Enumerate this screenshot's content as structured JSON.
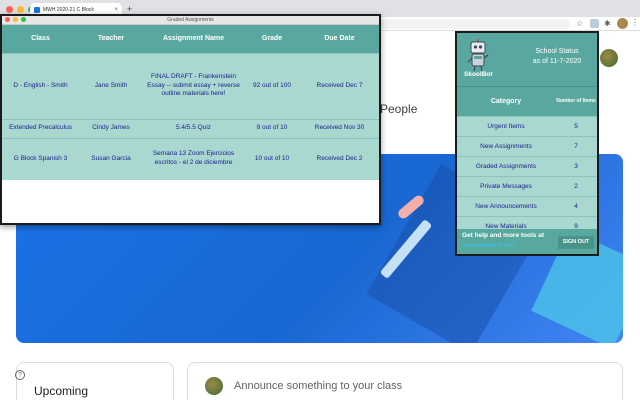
{
  "browser": {
    "tab_title": "MWH 2020-21 C Block",
    "tab_close": "×",
    "new_tab": "+",
    "star": "☆",
    "extensions": "✱",
    "menu": "⋮"
  },
  "page": {
    "people_label": "People",
    "upcoming_label": "Upcoming",
    "help_icon": "?",
    "announce_placeholder": "Announce something to your class"
  },
  "graded": {
    "window_title": "Graded Assignments",
    "columns": [
      "Class",
      "Teacher",
      "Assignment Name",
      "Grade",
      "Due Date"
    ],
    "rows": [
      {
        "class": "D - English - Smith",
        "teacher": "Jane Smith",
        "assignment": "FINAL DRAFT - Frankenstein Essay -- submit essay + reverse outline materials here!",
        "grade": "92 out of 100",
        "due": "Received Dec 7"
      },
      {
        "class": "Extended Precalculus",
        "teacher": "Cindy James",
        "assignment": "5.4/5.5 Quiz",
        "grade": "8 out of 10",
        "due": "Received Nov 30"
      },
      {
        "class": "G Block Spanish 3",
        "teacher": "Susan Garcia",
        "assignment": "Semana 13 Zoom Ejercicios escritos - el 2 de diciembre",
        "grade": "10 out of 10",
        "due": "Received Dec 2"
      }
    ]
  },
  "status": {
    "brand": "SkoolBot",
    "title_line1": "School Status",
    "title_line2": "as of 11-7-2020",
    "col_category": "Category",
    "col_number": "Number of Items",
    "items": [
      {
        "label": "Urgent Items",
        "count": "5"
      },
      {
        "label": "New Assignments",
        "count": "7"
      },
      {
        "label": "Graded Assignments",
        "count": "3"
      },
      {
        "label": "Private Messages",
        "count": "2"
      },
      {
        "label": "New Announcements",
        "count": "4"
      },
      {
        "label": "New Materials",
        "count": "9"
      }
    ],
    "help_text": "Get help and more tools at",
    "help_link": "www.skoolbot.com",
    "signout_label": "SIGN OUT"
  }
}
